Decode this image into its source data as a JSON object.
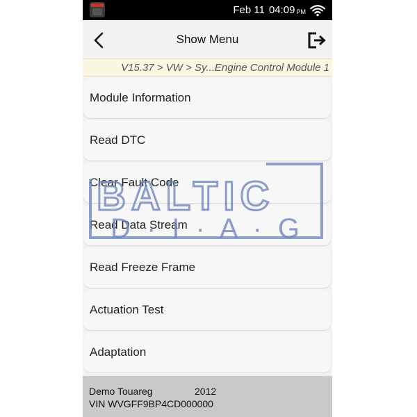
{
  "status_bar": {
    "date": "Feb 11",
    "time": "04:09",
    "ampm": "PM"
  },
  "header": {
    "title": "Show Menu",
    "back_icon": "chevron-left-icon",
    "exit_icon": "exit-icon"
  },
  "breadcrumb": "V15.37 > VW > Sy...Engine Control Module 1",
  "menu": {
    "items": [
      {
        "label": "Module Information"
      },
      {
        "label": "Read DTC"
      },
      {
        "label": "Clear Fault Code"
      },
      {
        "label": "Read Data Stream"
      },
      {
        "label": "Read Freeze Frame"
      },
      {
        "label": "Actuation Test"
      },
      {
        "label": "Adaptation"
      }
    ]
  },
  "watermark": {
    "line1": "BALTIC",
    "line2": "D · I · A · G",
    "color": "#6f86bf"
  },
  "footer": {
    "vehicle": "Demo Touareg",
    "year": "2012",
    "vin": "VIN WVGFF9BP4CD000000"
  },
  "colors": {
    "breadcrumb_bg": "#faf6e2",
    "footer_bg": "#c9c9c9",
    "status_bar_bg": "#000000"
  }
}
